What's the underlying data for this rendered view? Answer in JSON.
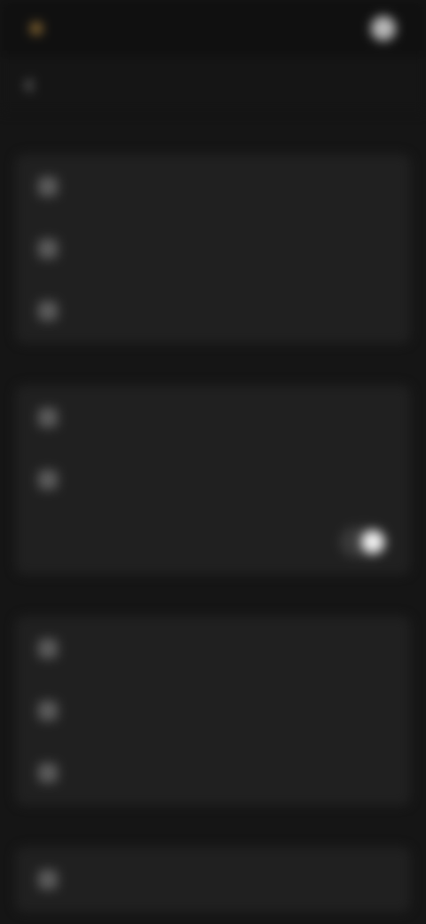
{
  "status": {
    "brand": "",
    "right_text": "",
    "avatar": "avatar"
  },
  "header": {
    "title": "",
    "back_icon": "chevron-left-icon"
  },
  "sections": [
    {
      "label": "",
      "items": [
        {
          "label": "",
          "value": ""
        },
        {
          "label": "",
          "value": ""
        },
        {
          "label": "",
          "value": ""
        }
      ]
    },
    {
      "label": "",
      "items": [
        {
          "label": "",
          "value": ""
        },
        {
          "label": "",
          "value": ""
        },
        {
          "label": "",
          "toggle_on": true
        }
      ]
    },
    {
      "label": "",
      "items": [
        {
          "label": "",
          "value": ""
        },
        {
          "label": "",
          "value": ""
        },
        {
          "label": "",
          "value": ""
        }
      ]
    },
    {
      "label": "",
      "items": [
        {
          "label": "",
          "value": ""
        }
      ]
    }
  ],
  "colors": {
    "background": "#151515",
    "card": "#202020",
    "accent_brand": "#a98c57",
    "toggle_knob": "#f2f2f2"
  }
}
